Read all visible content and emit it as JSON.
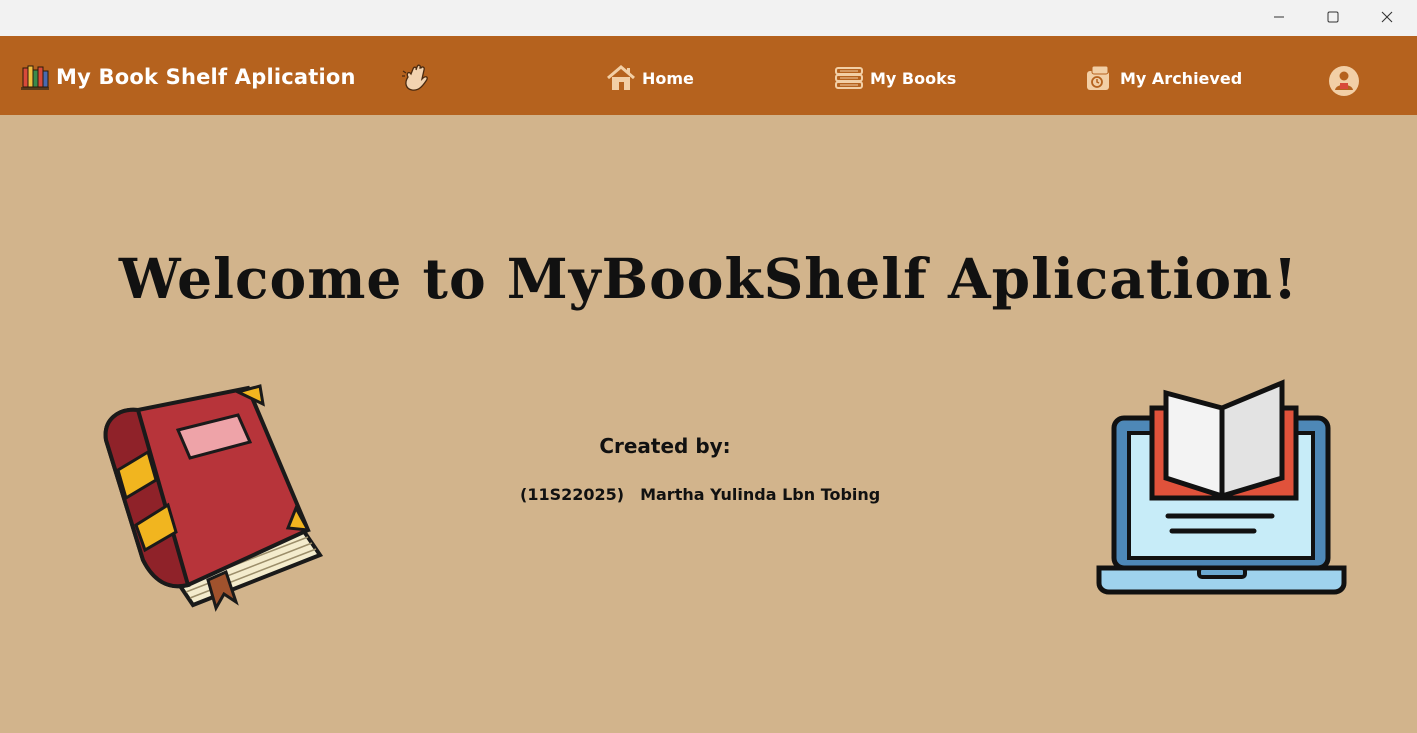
{
  "window": {
    "controls": {
      "minimize_icon": "minimize-icon",
      "maximize_icon": "maximize-icon",
      "close_icon": "close-icon"
    }
  },
  "navbar": {
    "brand_title": "My Book Shelf Aplication",
    "brand_icon": "bookshelf-icon",
    "wave_icon": "waving-hand-icon",
    "items": [
      {
        "label": "Home",
        "icon": "home-icon"
      },
      {
        "label": "My Books",
        "icon": "books-stack-icon"
      },
      {
        "label": "My Archieved",
        "icon": "archive-icon"
      }
    ],
    "profile_icon": "profile-icon"
  },
  "main": {
    "welcome_title": "Welcome to MyBookShelf Aplication!",
    "credit_heading": "Created by:",
    "credit_nim": "(11S22025)",
    "credit_name": "Martha Yulinda Lbn Tobing"
  },
  "colors": {
    "navbar_bg": "#b5621e",
    "page_bg": "#d2b48c",
    "titlebar_bg": "#f2f2f2",
    "nav_text": "#ffffff"
  }
}
